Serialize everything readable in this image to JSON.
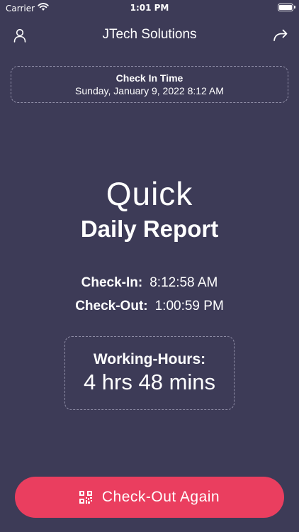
{
  "status_bar": {
    "carrier": "Carrier",
    "time": "1:01 PM",
    "icons": [
      "wifi-icon",
      "battery-icon"
    ]
  },
  "nav": {
    "title": "JTech Solutions",
    "left_icon": "user-icon",
    "right_icon": "share-icon"
  },
  "checkin_card": {
    "title": "Check In Time",
    "datetime": "Sunday, January 9, 2022 8:12 AM"
  },
  "report": {
    "heading_light": "Quick",
    "heading_bold": "Daily Report",
    "check_in_label": "Check-In:",
    "check_in_value": "8:12:58 AM",
    "check_out_label": "Check-Out:",
    "check_out_value": "1:00:59 PM",
    "working_hours_label": "Working-Hours:",
    "working_hours_value": "4 hrs 48 mins"
  },
  "action": {
    "label": "Check-Out Again",
    "icon": "qr-code-icon"
  },
  "colors": {
    "background": "#3d3b57",
    "accent": "#ea3e5f",
    "dashed_border": "#8f8da6",
    "text": "#ffffff"
  }
}
